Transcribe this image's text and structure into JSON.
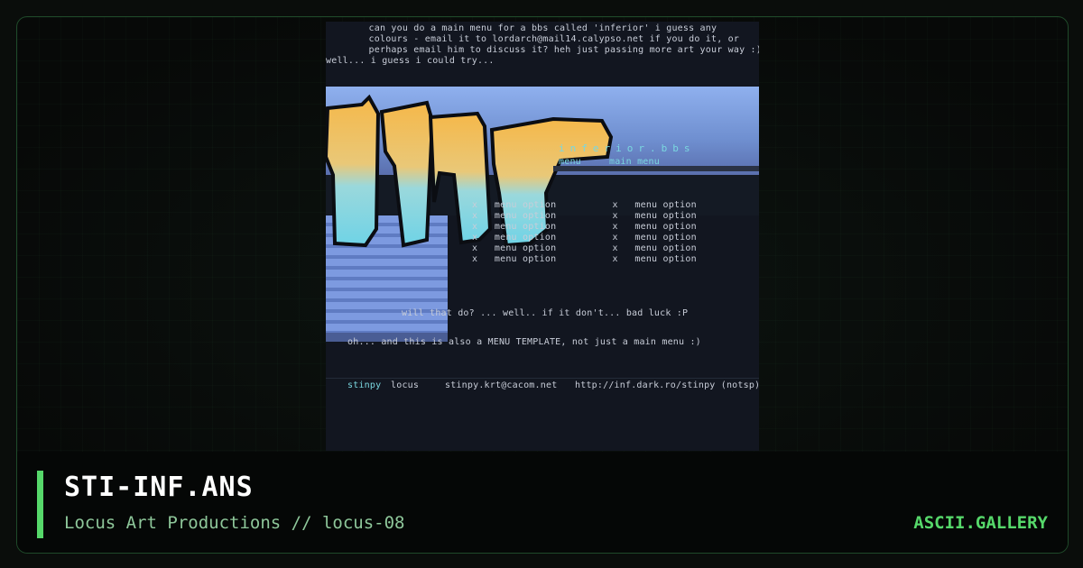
{
  "art": {
    "intro_lines": [
      "       can you do a main menu for a bbs called 'inferior' i guess any",
      "       colours - email it to lordarch@mail14.calypso.net if you do it, or",
      "       perhaps email him to discuss it? heh just passing more art your way :)",
      "well... i guess i could try..."
    ],
    "logo_tag": "inferior.bbs",
    "menu_header": "menu     main menu",
    "menu_rows": [
      "x   menu option          x   menu option",
      "x   menu option          x   menu option",
      "x   menu option          x   menu option",
      "x   menu option          x   menu option",
      "x   menu option          x   menu option",
      "x   menu option          x   menu option"
    ],
    "closing_line_1": "will that do? ... well.. if it don't... bad luck :P",
    "closing_line_2": "oh... and this is also a MENU TEMPLATE, not just a main menu :)",
    "credits": {
      "handle": "stinpy",
      "group": "locus",
      "email": "stinpy.krt@cacom.net",
      "url": "http://inf.dark.ro/stinpy (notsp)"
    }
  },
  "footer": {
    "title": "STI-INF.ANS",
    "subtitle": "Locus Art Productions // locus-08",
    "brand": "ASCII.GALLERY"
  },
  "colors": {
    "accent": "#56d86a",
    "logo_top": "#f0b34a",
    "logo_bottom": "#7ad7e0",
    "panel_blue": "#8fb0ee"
  }
}
